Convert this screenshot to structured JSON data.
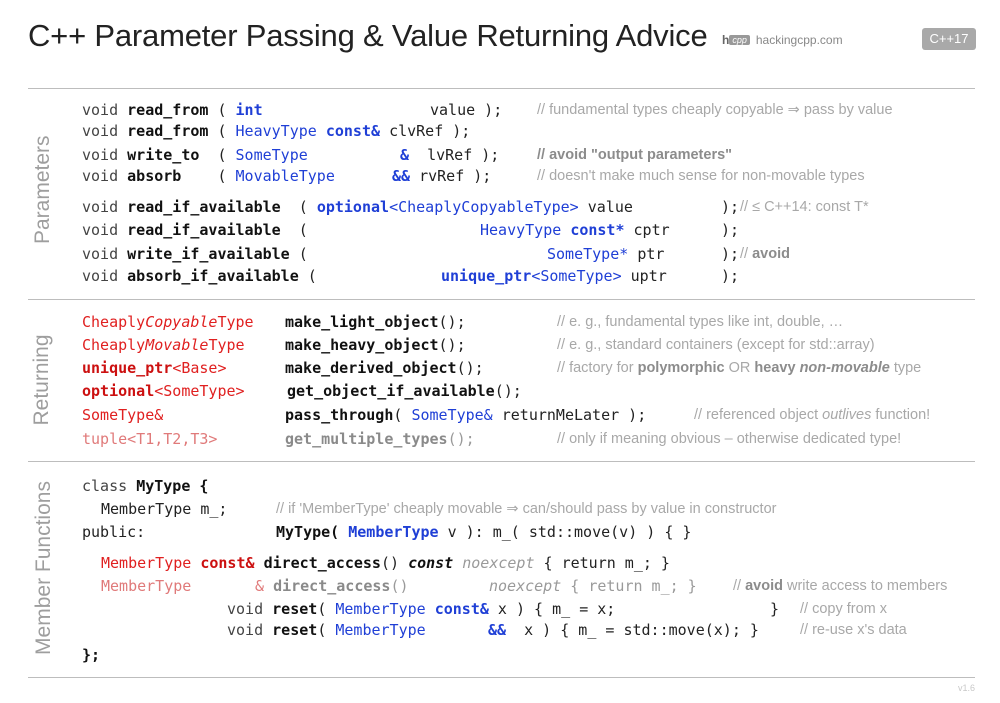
{
  "header": {
    "title": "C++ Parameter Passing & Value Returning Advice",
    "logo_h": "h",
    "logo_cpp": "cpp",
    "logo_text": "hackingcpp.com",
    "badge": "C++17"
  },
  "sections": {
    "parameters": "Parameters",
    "returning": "Returning",
    "member_functions": "Member Functions"
  },
  "params": {
    "rows": [
      {
        "ret": "void",
        "fn": "read_from",
        "open": " ( ",
        "type": "int",
        "mod": "",
        "name": "value",
        "close": " );",
        "comment": "// fundamental types cheaply copyable ⇒ pass by value"
      },
      {
        "ret": "void",
        "fn": "read_from",
        "open": " ( ",
        "type": "HeavyType",
        "mod": "const&",
        "name": "clvRef",
        "close": " );",
        "comment": ""
      },
      {
        "ret": "void",
        "fn": "write_to",
        "open": "  ( ",
        "type": "SomeType",
        "mod": "&",
        "name": "lvRef",
        "close": " );",
        "comment": "// avoid \"output parameters\""
      },
      {
        "ret": "void",
        "fn": "absorb",
        "open": "    ( ",
        "type": "MovableType",
        "mod": "&&",
        "name": "rvRef",
        "close": " );",
        "comment": "// doesn't make much sense for non-movable types"
      }
    ],
    "opt_rows": [
      {
        "ret": "void",
        "fn": "read_if_available",
        "open": "  ( ",
        "tmpl": "optional",
        "type": "<CheaplyCopyableType>",
        "name": "value",
        "close": " );",
        "comment": "// ≤ C++14: const T*"
      },
      {
        "ret": "void",
        "fn": "read_if_available",
        "open": "  ( ",
        "tmpl": "",
        "type": "HeavyType",
        "mod": "const*",
        "name": "cptr",
        "close": " );",
        "comment": ""
      },
      {
        "ret": "void",
        "fn": "write_if_available",
        "open": " ( ",
        "tmpl": "",
        "type": "SomeType*",
        "mod": "",
        "name": "ptr",
        "close": " );",
        "comment": "// avoid"
      },
      {
        "ret": "void",
        "fn": "absorb_if_available",
        "open": " ( ",
        "tmpl": "unique_ptr",
        "type": "<SomeType>",
        "name": "uptr",
        "close": " );",
        "comment": ""
      }
    ]
  },
  "returning": {
    "rows": [
      {
        "t1": "Cheaply",
        "t2": "Copyable",
        "t3": "Type",
        "fn": "make_light_object",
        "args": "();",
        "comment": "// e. g., fundamental types like int, double, …"
      },
      {
        "t1": "Cheaply",
        "t2": "Movable",
        "t3": "Type",
        "fn": "make_heavy_object",
        "args": "();",
        "comment": "// e. g., standard containers (except for std::array)"
      },
      {
        "t1": "unique_ptr",
        "t2": "<Base>",
        "t3": "",
        "fn": "make_derived_object",
        "args": "();",
        "comment_a": "// factory for ",
        "comment_b": "polymorphic",
        "comment_c": " OR ",
        "comment_d": "heavy ",
        "comment_e": "non-movable",
        "comment_f": " type"
      },
      {
        "t1": "optional",
        "t2": "<SomeType>",
        "t3": "",
        "fn": "get_object_if_available",
        "args": "();",
        "comment": ""
      },
      {
        "t1": "SomeType&",
        "fn": "pass_through",
        "args_a": "( ",
        "args_type": "SomeType&",
        "args_b": " returnMeLater );",
        "comment_a": "// referenced object ",
        "comment_b": "outlives",
        "comment_c": " function!"
      },
      {
        "t1": "tuple<T1,T2,T3>",
        "fn": "get_multiple_types",
        "args": "();",
        "comment": "// only if meaning obvious – otherwise dedicated type!"
      }
    ]
  },
  "members": {
    "class_kw": "class",
    "class_name": "MyType {",
    "member_decl": "MemberType m_;",
    "member_comment": "// if 'MemberType' cheaply movable ⇒ can/should pass by value in constructor",
    "public_kw": "public:",
    "ctor": "MyType(",
    "ctor_type": "MemberType",
    "ctor_rest": " v ): m_( std::move(v) ) { }",
    "acc1_type": "MemberType",
    "acc1_mod": "const&",
    "acc1_fn": "direct_access",
    "acc1_paren": "()",
    "acc1_const": "const",
    "acc1_noexcept": "noexcept",
    "acc1_body": "{ return m_; }",
    "acc2_type": "MemberType",
    "acc2_mod": "&",
    "acc2_fn": "direct_access",
    "acc2_paren": "()",
    "acc2_noexcept": "noexcept",
    "acc2_body": "{ return m_; }",
    "acc2_comment_a": "// ",
    "acc2_comment_b": "avoid",
    "acc2_comment_c": " write access to members",
    "reset1_void": "void",
    "reset1_fn": "reset",
    "reset1_paren": "(",
    "reset1_type": "MemberType",
    "reset1_mod": "const&",
    "reset1_rest": " x ) { m_ = x;",
    "reset1_close": "}",
    "reset1_comment": "// copy from x",
    "reset2_void": "void",
    "reset2_fn": "reset",
    "reset2_paren": "(",
    "reset2_type": "MemberType",
    "reset2_mod": "&&",
    "reset2_rest": " x ) { m_ = std::move(x); }",
    "reset2_comment": "// re-use x's data",
    "end": "};"
  },
  "footer": {
    "version": "v1.6"
  }
}
